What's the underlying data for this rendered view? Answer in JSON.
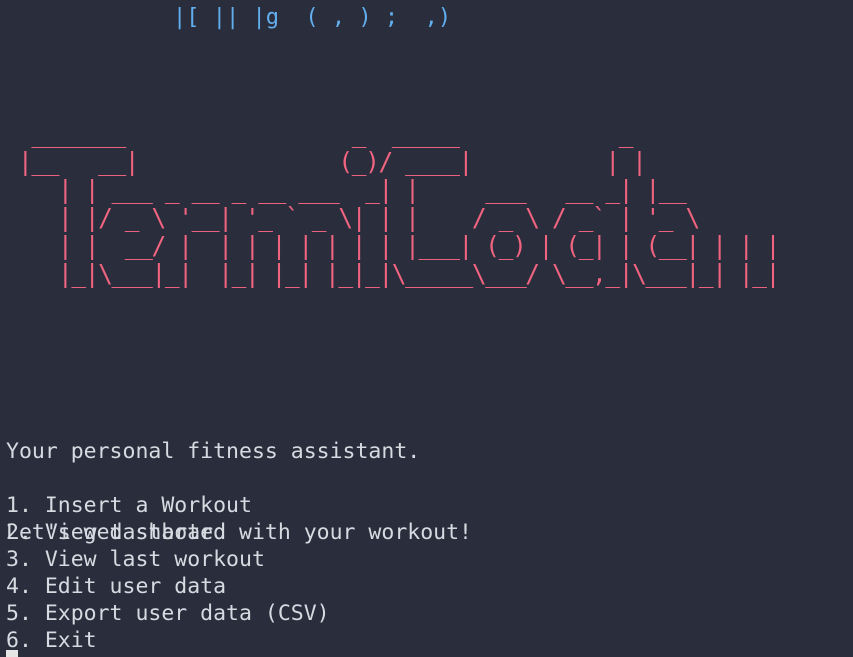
{
  "terminal": {
    "top_fragment": {
      "text": "|[ || |g  ( , ) ;  ,)",
      "colors": [
        "#61afef",
        "#c678dd",
        "#e5c07b",
        "#d7dae0"
      ]
    },
    "banner_lines": [
      " _______                 _  _____            _      ",
      "|__   __|               (_)/ ____|          | |     ",
      "   | | ___ _ __ _ __ ___  _| |     ___   __ _| |__   ",
      "   | |/ _ \\ '__| '_ ` _ \\| | |    / _ \\ / _` | '_ \\  ",
      "   | |  __/ |  | | | | | | | |___| (_) | (_| | (__| | | | ",
      "   |_|\\___|_|  |_| |_| |_|_|\\_____\\___/ \\__,_|\\___|_| |_| "
    ],
    "tagline": [
      "Your personal fitness assistant.",
      "Let's get started with your workout!"
    ],
    "menu": [
      "1. Insert a Workout",
      "2. View dashboard",
      "3. View last workout",
      "4. Edit user data",
      "5. Export user data (CSV)",
      "6. Exit"
    ],
    "colors": {
      "background": "#2a2d3c",
      "foreground": "#d7dae0",
      "banner": "#f06480",
      "cursor": "#e6e6e6"
    }
  }
}
